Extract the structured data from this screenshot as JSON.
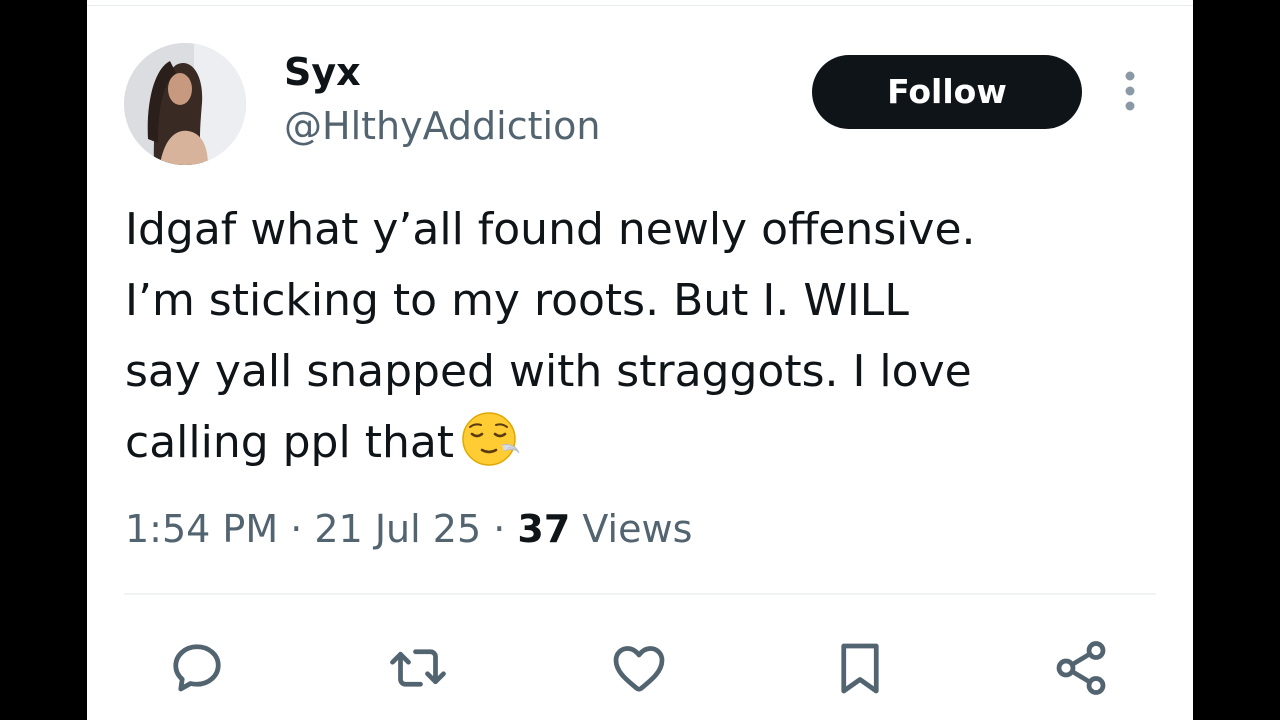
{
  "user": {
    "display_name": "Syx",
    "handle": "@HlthyAddiction"
  },
  "follow_button": {
    "label": "Follow"
  },
  "tweet": {
    "lines": [
      "Idgaf what y’all found newly offensive.",
      "I’m sticking to my roots. But I. WILL",
      "say yall snapped with straggots. I love",
      "calling ppl that"
    ],
    "emoji": "relieved-face"
  },
  "meta": {
    "time": "1:54 PM",
    "separator": "·",
    "date": "21 Jul 25",
    "views_count": "37",
    "views_label": "Views"
  },
  "actions": [
    "reply-icon",
    "retweet-icon",
    "like-icon",
    "bookmark-icon",
    "share-icon"
  ],
  "colors": {
    "text_primary": "#0f1419",
    "text_secondary": "#536471",
    "follow_bg": "#0f1419",
    "follow_text": "#ffffff",
    "divider": "#eff3f4"
  }
}
